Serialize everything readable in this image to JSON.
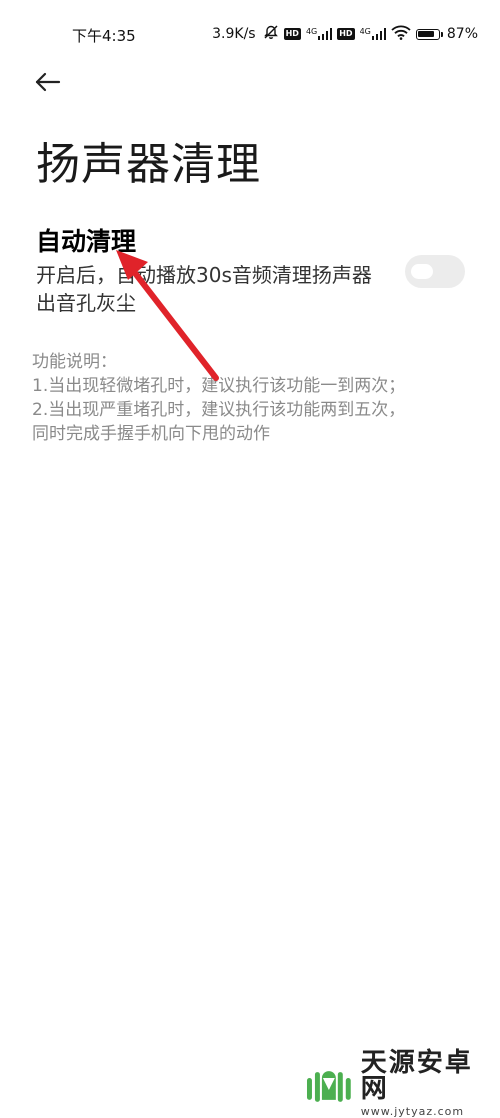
{
  "status_bar": {
    "time": "下午4:35",
    "net_speed": "3.9K/s",
    "net_label_1": "4G",
    "net_label_2": "4G",
    "hd_label_1": "HD",
    "hd_label_2": "HD",
    "battery_percent": "87%",
    "battery_level": 0.87
  },
  "header": {
    "title": "扬声器清理"
  },
  "auto_clean": {
    "title": "自动清理",
    "description_line1": "开启后，自动播放30s音频清理扬声器",
    "description_line2": "出音孔灰尘",
    "enabled": false
  },
  "function_description": {
    "heading": "功能说明：",
    "line1": "1.当出现轻微堵孔时，建议执行该功能一到两次；",
    "line2": "2.当出现严重堵孔时，建议执行该功能两到五次，",
    "line3": "同时完成手握手机向下甩的动作"
  },
  "watermark": {
    "name": "天源安卓网",
    "url": "www.jytyaz.com"
  },
  "colors": {
    "annotation_arrow": "#e0232a",
    "toggle_off": "#ececec",
    "watermark_green": "#4caf50"
  }
}
